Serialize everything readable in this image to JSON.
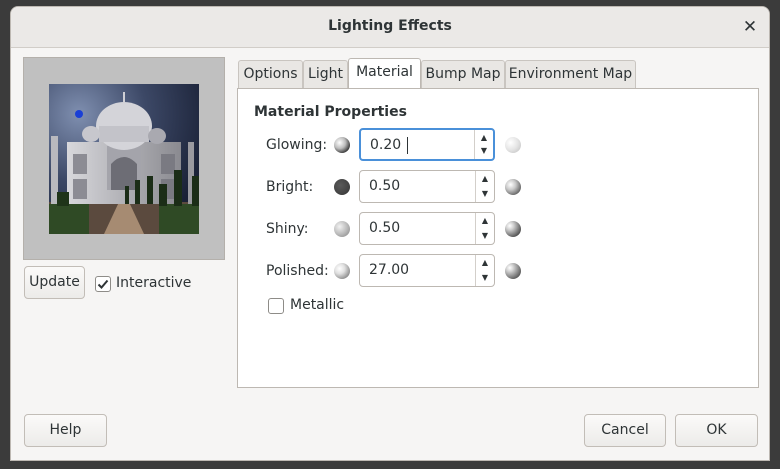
{
  "window": {
    "title": "Lighting Effects"
  },
  "preview": {
    "update_label": "Update",
    "interactive_label": "Interactive",
    "interactive_checked": true
  },
  "tabs": [
    {
      "label": "Options"
    },
    {
      "label": "Light"
    },
    {
      "label": "Material"
    },
    {
      "label": "Bump Map"
    },
    {
      "label": "Environment Map"
    }
  ],
  "active_tab": "Material",
  "material": {
    "heading": "Material Properties",
    "glowing": {
      "label": "Glowing:",
      "value": "0.20"
    },
    "bright": {
      "label": "Bright:",
      "value": "0.50"
    },
    "shiny": {
      "label": "Shiny:",
      "value": "0.50"
    },
    "polished": {
      "label": "Polished:",
      "value": "27.00"
    },
    "metallic": {
      "label": "Metallic",
      "checked": false
    }
  },
  "footer": {
    "help_label": "Help",
    "cancel_label": "Cancel",
    "ok_label": "OK"
  },
  "icons": {
    "close": "close-icon",
    "spin_up": "chevron-up-icon",
    "spin_down": "chevron-down-icon",
    "checkmark": "checkmark-icon",
    "sphere": "sphere-icon"
  },
  "colors": {
    "focus_accent": "#4a90d9",
    "light_handle": "#1a3fd6"
  }
}
